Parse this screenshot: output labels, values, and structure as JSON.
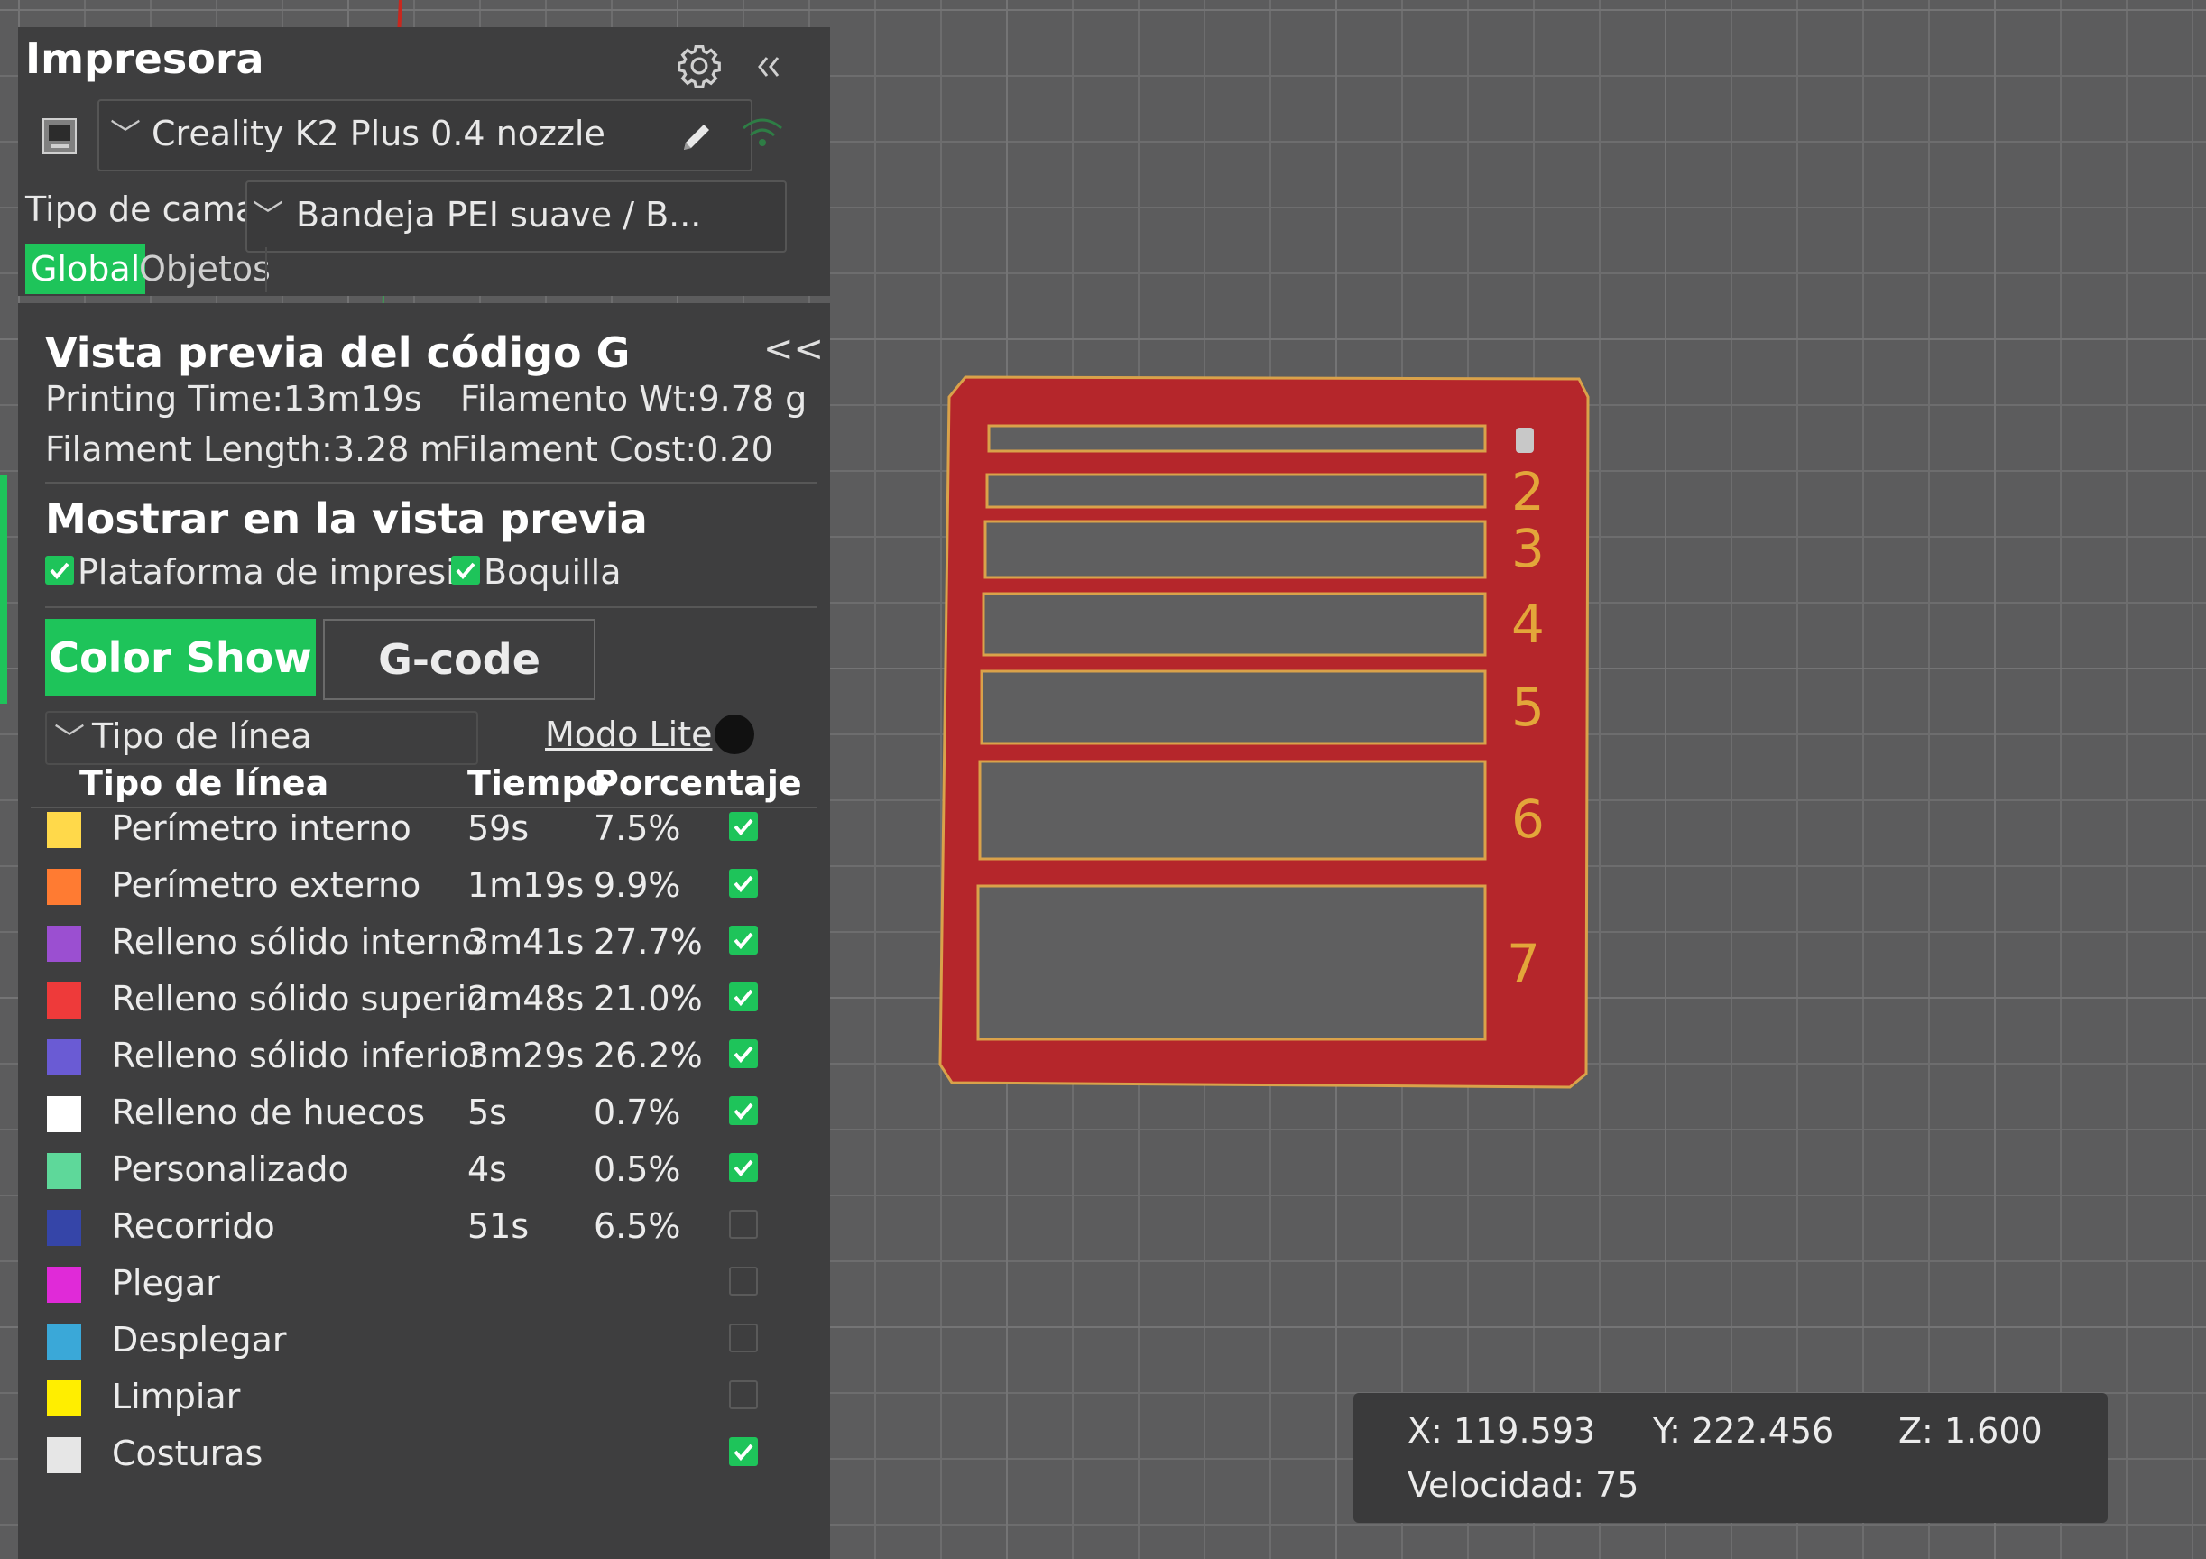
{
  "printer": {
    "title": "Impresora",
    "printer_name": "Creality K2 Plus 0.4 nozzle",
    "bed_label": "Tipo de cama",
    "bed_value": "Bandeja PEI suave / B...",
    "tabs": [
      "Global",
      "Objetos"
    ],
    "icons": [
      "settings-gear-icon",
      "collapse-chevrons-icon",
      "printer-icon",
      "edit-pencil-icon",
      "wifi-icon"
    ]
  },
  "preview": {
    "title": "Vista previa del código G",
    "collapse": "<<",
    "stats": {
      "printing_time": "Printing Time:13m19s",
      "filament_wt": "Filamento Wt:9.78 g",
      "filament_length": "Filament Length:3.28 m",
      "filament_cost": "Filament Cost:0.20"
    },
    "show_title": "Mostrar en la vista previa",
    "show_options": [
      {
        "label": "Plataforma de impresió",
        "checked": true
      },
      {
        "label": "Boquilla",
        "checked": true
      }
    ],
    "buttons": {
      "color_show": "Color Show",
      "gcode": "G-code"
    },
    "line_type_dropdown": "Tipo de línea",
    "lite_mode": "Modo Lite",
    "headers": {
      "type": "Tipo de línea",
      "time": "Tiempo",
      "percent": "Porcentaje"
    },
    "rows": [
      {
        "label": "Perímetro interno",
        "time": "59s",
        "percent": "7.5%",
        "color": "#ffd94a",
        "checked": true
      },
      {
        "label": "Perímetro externo",
        "time": "1m19s",
        "percent": "9.9%",
        "color": "#ff7b32",
        "checked": true
      },
      {
        "label": "Relleno sólido interno",
        "time": "3m41s",
        "percent": "27.7%",
        "color": "#9b4fd1",
        "checked": true
      },
      {
        "label": "Relleno sólido superior",
        "time": "2m48s",
        "percent": "21.0%",
        "color": "#ee3a3a",
        "checked": true
      },
      {
        "label": "Relleno sólido inferior",
        "time": "3m29s",
        "percent": "26.2%",
        "color": "#6a5bd4",
        "checked": true
      },
      {
        "label": "Relleno de huecos",
        "time": "5s",
        "percent": "0.7%",
        "color": "#ffffff",
        "checked": true
      },
      {
        "label": "Personalizado",
        "time": "4s",
        "percent": "0.5%",
        "color": "#5ed89a",
        "checked": true
      },
      {
        "label": "Recorrido",
        "time": "51s",
        "percent": "6.5%",
        "color": "#3545a8",
        "checked": false
      },
      {
        "label": "Plegar",
        "time": "",
        "percent": "",
        "color": "#e02ad8",
        "checked": false
      },
      {
        "label": "Desplegar",
        "time": "",
        "percent": "",
        "color": "#3aa8d8",
        "checked": false
      },
      {
        "label": "Limpiar",
        "time": "",
        "percent": "",
        "color": "#ffee00",
        "checked": false
      },
      {
        "label": "Costuras",
        "time": "",
        "percent": "",
        "color": "#e6e6e6",
        "checked": true
      }
    ]
  },
  "model": {
    "color": "#b5262b",
    "edge_color": "#d9a24a",
    "numbers": [
      "2",
      "3",
      "4",
      "5",
      "6",
      "7"
    ]
  },
  "coords": {
    "x": "X: 119.593",
    "y": "Y: 222.456",
    "z": "Z: 1.600",
    "speed": "Velocidad: 75"
  }
}
